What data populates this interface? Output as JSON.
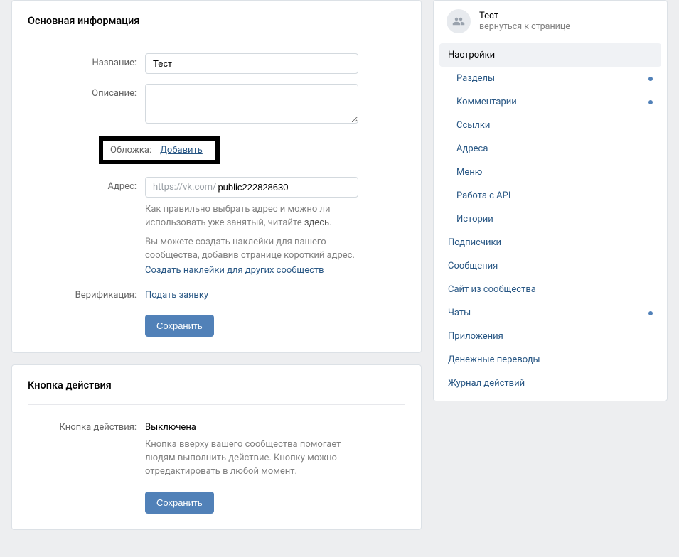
{
  "main": {
    "title": "Основная информация",
    "labels": {
      "name": "Название:",
      "description": "Описание:",
      "cover": "Обложка:",
      "address": "Адрес:",
      "verification": "Верификация:"
    },
    "name_value": "Тест",
    "description_value": "",
    "cover_link": "Добавить",
    "address_prefix": "https://vk.com/",
    "address_value": "public222828630",
    "hint_address_1": "Как правильно выбрать адрес и можно ли использовать уже занятый, читайте ",
    "hint_address_here": "здесь",
    "hint_address_dot": ".",
    "hint_stickers_1": "Вы можете создать наклейки для вашего сообщества, добавив странице короткий адрес.",
    "hint_stickers_link": "Создать наклейки для других сообществ",
    "verification_link": "Подать заявку",
    "save_label": "Сохранить"
  },
  "action": {
    "title": "Кнопка действия",
    "label": "Кнопка действия:",
    "state": "Выключена",
    "hint": "Кнопка вверху вашего сообщества помогает людям выполнить действие. Кнопку можно отредактировать в любой момент.",
    "save_label": "Сохранить"
  },
  "sidebar": {
    "group_name": "Тест",
    "back_link": "вернуться к странице",
    "items": [
      {
        "label": "Настройки",
        "active": true,
        "sub": false,
        "dot": false
      },
      {
        "label": "Разделы",
        "active": false,
        "sub": true,
        "dot": true
      },
      {
        "label": "Комментарии",
        "active": false,
        "sub": true,
        "dot": true
      },
      {
        "label": "Ссылки",
        "active": false,
        "sub": true,
        "dot": false
      },
      {
        "label": "Адреса",
        "active": false,
        "sub": true,
        "dot": false
      },
      {
        "label": "Меню",
        "active": false,
        "sub": true,
        "dot": false
      },
      {
        "label": "Работа с API",
        "active": false,
        "sub": true,
        "dot": false
      },
      {
        "label": "Истории",
        "active": false,
        "sub": true,
        "dot": false
      },
      {
        "label": "Подписчики",
        "active": false,
        "sub": false,
        "dot": false
      },
      {
        "label": "Сообщения",
        "active": false,
        "sub": false,
        "dot": false
      },
      {
        "label": "Сайт из сообщества",
        "active": false,
        "sub": false,
        "dot": false
      },
      {
        "label": "Чаты",
        "active": false,
        "sub": false,
        "dot": true
      },
      {
        "label": "Приложения",
        "active": false,
        "sub": false,
        "dot": false
      },
      {
        "label": "Денежные переводы",
        "active": false,
        "sub": false,
        "dot": false
      },
      {
        "label": "Журнал действий",
        "active": false,
        "sub": false,
        "dot": false
      }
    ]
  }
}
